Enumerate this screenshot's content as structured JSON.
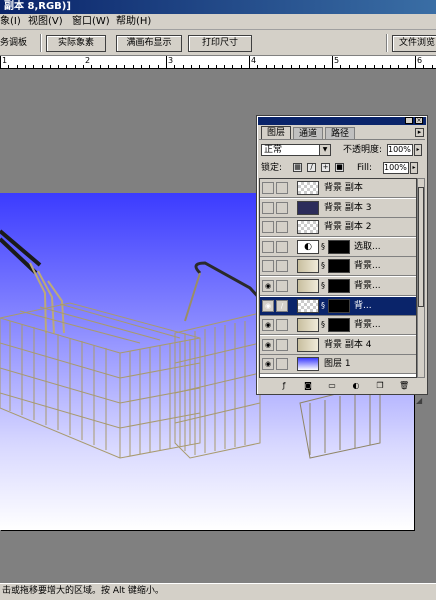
{
  "window": {
    "title": "副本 8,RGB)]"
  },
  "menubar": {
    "items": [
      "象(I)",
      "视图(V)",
      "窗口(W)",
      "帮助(H)"
    ]
  },
  "options_bar": {
    "partial_label": "务调板",
    "buttons": [
      "实际象素",
      "满画布显示",
      "打印尺寸"
    ],
    "right_button": "文件浏览"
  },
  "ruler": {
    "numbers": [
      "1",
      "2",
      "3",
      "4",
      "5",
      "6"
    ]
  },
  "layers_panel": {
    "tabs": [
      "图层",
      "通道",
      "路径"
    ],
    "blend_mode": "正常",
    "opacity_label": "不透明度:",
    "opacity_value": "100%",
    "lock_label": "锁定:",
    "fill_label": "Fill:",
    "fill_value": "100%",
    "layers": [
      {
        "name": "背景 副本",
        "visible": false,
        "thumb": "checker",
        "mask": false,
        "selected": false
      },
      {
        "name": "背景 副本 3",
        "visible": false,
        "thumb": "dark",
        "mask": false,
        "selected": false
      },
      {
        "name": "背景 副本 2",
        "visible": false,
        "thumb": "checker",
        "mask": false,
        "selected": false
      },
      {
        "name": "选取...",
        "visible": false,
        "thumb": "adjust",
        "mask": true,
        "selected": false
      },
      {
        "name": "背景...",
        "visible": false,
        "thumb": "photo",
        "mask": true,
        "selected": false
      },
      {
        "name": "背景...",
        "visible": true,
        "thumb": "photo",
        "mask": true,
        "selected": false
      },
      {
        "name": "背...",
        "visible": true,
        "thumb": "checker",
        "mask": true,
        "selected": true
      },
      {
        "name": "背景...",
        "visible": true,
        "thumb": "photo",
        "mask": true,
        "selected": false
      },
      {
        "name": "背景 副本 4",
        "visible": true,
        "thumb": "photo",
        "mask": false,
        "selected": false
      },
      {
        "name": "图层 1",
        "visible": true,
        "thumb": "gradient",
        "mask": false,
        "selected": false
      }
    ],
    "bottom_icons": [
      "layer-style-icon",
      "mask-icon",
      "new-set-icon",
      "adjustment-icon",
      "new-layer-icon",
      "trash-icon"
    ]
  },
  "statusbar": {
    "text": "击或拖移要增大的区域。按 Alt 键缩小。"
  },
  "colors": {
    "selection": "#0a246a",
    "ui_gray": "#d4d0c8",
    "gradient_top": "#3b3bff"
  }
}
